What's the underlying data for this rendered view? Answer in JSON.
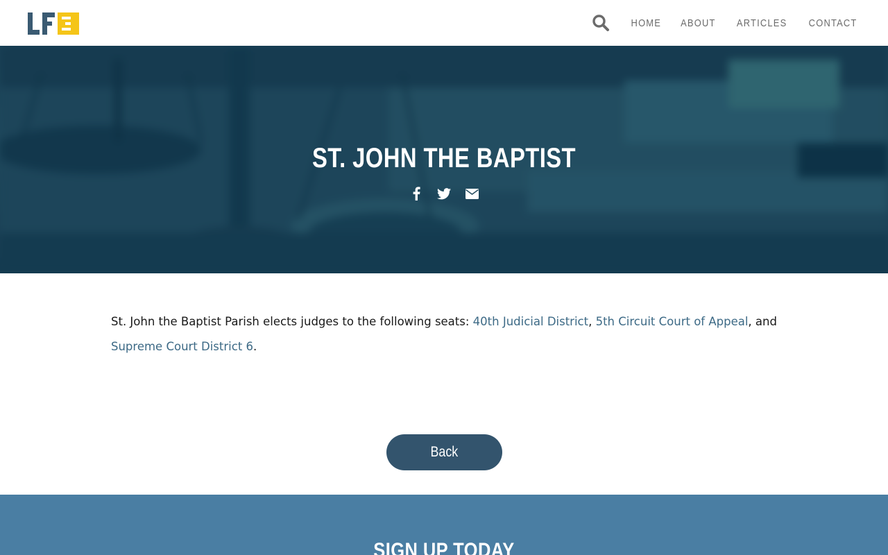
{
  "brand": {
    "logo_text": "LFE",
    "logo_colors": {
      "dark": "#3a5a72",
      "accent": "#f5c518"
    }
  },
  "nav": {
    "search_icon": "search-icon",
    "items": [
      {
        "label": "HOME"
      },
      {
        "label": "ABOUT"
      },
      {
        "label": "ARTICLES"
      },
      {
        "label": "CONTACT"
      }
    ]
  },
  "hero": {
    "title": "ST. JOHN THE BAPTIST",
    "share_icons": [
      "facebook-icon",
      "twitter-icon",
      "envelope-icon"
    ]
  },
  "content": {
    "intro": "St. John the Baptist Parish elects judges to the following seats: ",
    "links": [
      {
        "label": "40th Judicial District"
      },
      {
        "label": "5th Circuit Court of Appeal"
      },
      {
        "label": "Supreme Court District 6"
      }
    ],
    "sep1": ", ",
    "sep2": ", and ",
    "end": "."
  },
  "back_button": {
    "label": "Back"
  },
  "signup": {
    "title": "SIGN UP TODAY"
  },
  "colors": {
    "link": "#3d6a86",
    "button": "#33546d",
    "signup_band": "#4a7ea3",
    "nav_text": "#6b6b6b"
  }
}
